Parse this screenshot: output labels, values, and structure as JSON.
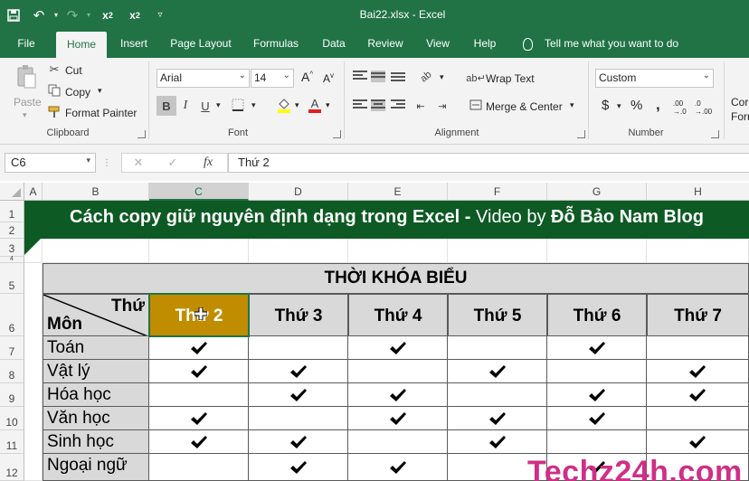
{
  "window": {
    "title": "Bai22.xlsx  -  Excel"
  },
  "qat": {
    "subscript": "x",
    "subscript_mark": "2",
    "superscript": "x",
    "superscript_mark": "2"
  },
  "menu": {
    "tabs": [
      "File",
      "Home",
      "Insert",
      "Page Layout",
      "Formulas",
      "Data",
      "Review",
      "View",
      "Help"
    ],
    "active": "Home",
    "tell_me": "Tell me what you want to do"
  },
  "ribbon": {
    "clipboard": {
      "paste": "Paste",
      "cut": "Cut",
      "copy": "Copy",
      "format_painter": "Format Painter",
      "label": "Clipboard"
    },
    "font": {
      "name": "Arial",
      "size": "14",
      "bold": "B",
      "italic": "I",
      "underline": "U",
      "grow": "A",
      "shrink": "A",
      "color_letter": "A",
      "label": "Font"
    },
    "alignment": {
      "wrap_text": "Wrap Text",
      "merge_center": "Merge & Center",
      "label": "Alignment"
    },
    "number": {
      "format": "Custom",
      "currency": "$",
      "percent": "%",
      "comma": ",",
      "inc_decimal": ".00",
      "dec_decimal": ".0",
      "label": "Number"
    },
    "styles_partial": {
      "line1": "Cor",
      "line2": "Forr"
    }
  },
  "formula_bar": {
    "name_box": "C6",
    "fx": "fx",
    "value": "Thứ 2"
  },
  "sheet": {
    "columns": [
      "A",
      "B",
      "C",
      "D",
      "E",
      "F",
      "G",
      "H"
    ],
    "rows": [
      "1",
      "2",
      "3",
      "4",
      "5",
      "6",
      "7",
      "8",
      "9",
      "10",
      "11",
      "12"
    ],
    "selected_column": "C",
    "banner": {
      "bold_part": "Cách copy giữ nguyên định dạng trong Excel - ",
      "normal_part": "Video by ",
      "author": "Đỗ Bảo Nam Blog"
    },
    "table_title": "THỜI KHÓA BIỂU",
    "diag_top": "Thứ",
    "diag_bottom": "Môn",
    "day_headers": [
      "Thứ 2",
      "Thứ 3",
      "Thứ 4",
      "Thứ 5",
      "Thứ 6",
      "Thứ 7"
    ],
    "subjects": [
      {
        "name": "Toán",
        "checks": [
          true,
          false,
          true,
          false,
          true,
          false
        ]
      },
      {
        "name": "Vật lý",
        "checks": [
          true,
          true,
          false,
          true,
          false,
          true
        ]
      },
      {
        "name": "Hóa học",
        "checks": [
          false,
          true,
          true,
          false,
          true,
          true
        ]
      },
      {
        "name": "Văn học",
        "checks": [
          true,
          false,
          true,
          true,
          true,
          false
        ]
      },
      {
        "name": "Sinh học",
        "checks": [
          true,
          true,
          false,
          true,
          false,
          true
        ]
      },
      {
        "name": "Ngoại ngữ",
        "checks": [
          false,
          true,
          true,
          false,
          true,
          false
        ]
      }
    ]
  },
  "watermark": "Techz24h.com",
  "colors": {
    "excel_green": "#217346",
    "banner_green": "#0d5a24",
    "header_gray": "#d9d9d9",
    "active_cell_gold": "#c08d00",
    "watermark_pink": "#cf2f86"
  }
}
